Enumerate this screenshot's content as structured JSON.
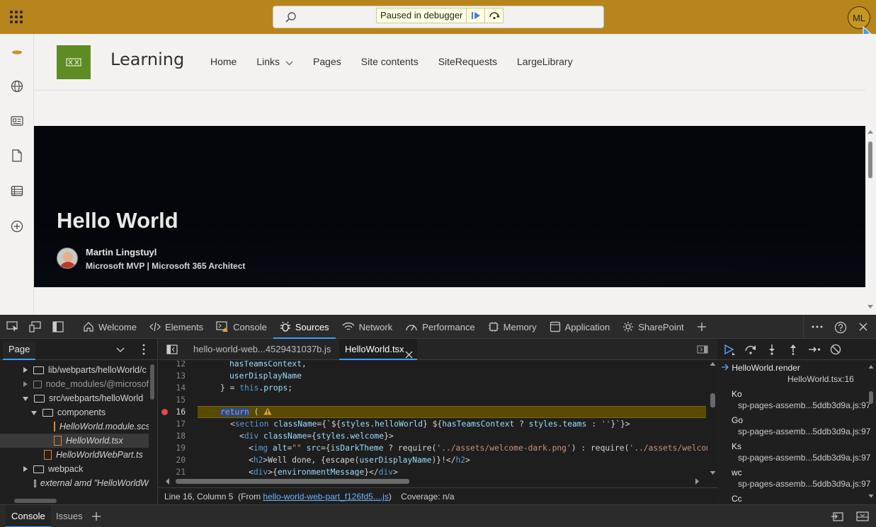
{
  "topbar": {
    "debugger_badge": "Paused in debugger",
    "account_initials": "ML"
  },
  "site": {
    "title": "Learning",
    "nav": [
      "Home",
      "Links",
      "Pages",
      "Site contents",
      "SiteRequests",
      "LargeLibrary"
    ]
  },
  "hero": {
    "title": "Hello World",
    "author_name": "Martin Lingstuyl",
    "author_role": "Microsoft MVP | Microsoft 365 Architect"
  },
  "devtools": {
    "tabs": [
      "Welcome",
      "Elements",
      "Console",
      "Sources",
      "Network",
      "Performance",
      "Memory",
      "Application",
      "SharePoint"
    ],
    "active_tab": "Sources",
    "navigator": {
      "tab": "Page",
      "tree": [
        "lib/webparts/helloWorld/c",
        "node_modules/@microsof",
        "src/webparts/helloWorld",
        "components",
        "HelloWorld.module.scss",
        "HelloWorld.tsx",
        "HelloWorldWebPart.ts",
        "webpack",
        "external amd \"HelloWorldW"
      ]
    },
    "editor": {
      "tabs": [
        "hello-world-web...4529431037b.js",
        "HelloWorld.tsx"
      ],
      "status_position": "Line 16, Column 5",
      "status_from_prefix": "(From ",
      "status_from_link": "hello-world-web-part_f126fd5....js",
      "status_from_suffix": ")",
      "status_coverage": "Coverage: n/a",
      "lines": {
        "n12": "12",
        "n13": "13",
        "n14": "14",
        "n15": "15",
        "n16": "16",
        "n17": "17",
        "n18": "18",
        "n19": "19",
        "n20": "20",
        "n21": "21"
      }
    },
    "callstack": {
      "top_name": "HelloWorld.render",
      "top_loc": "HelloWorld.tsx:16",
      "frames": [
        {
          "name": "Ko",
          "loc": "sp-pages-assemb...5ddb3d9a.js:97"
        },
        {
          "name": "Go",
          "loc": "sp-pages-assemb...5ddb3d9a.js:97"
        },
        {
          "name": "Ks",
          "loc": "sp-pages-assemb...5ddb3d9a.js:97"
        },
        {
          "name": "wc",
          "loc": "sp-pages-assemb...5ddb3d9a.js:97"
        },
        {
          "name": "Cc",
          "loc": ""
        }
      ]
    },
    "drawer": {
      "tabs": [
        "Console",
        "Issues"
      ]
    }
  }
}
